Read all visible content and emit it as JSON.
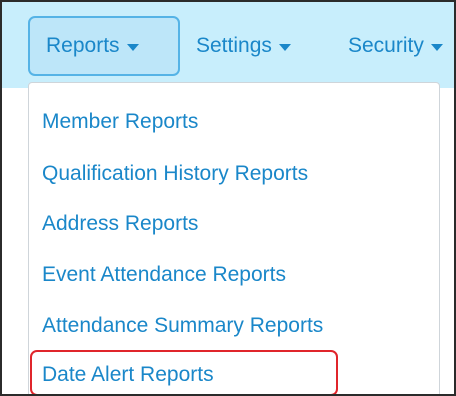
{
  "navbar": {
    "items": [
      {
        "label": "Reports"
      },
      {
        "label": "Settings"
      },
      {
        "label": "Security"
      }
    ]
  },
  "dropdown": {
    "items": [
      {
        "label": "Member Reports"
      },
      {
        "label": "Qualification History Reports"
      },
      {
        "label": "Address Reports"
      },
      {
        "label": "Event Attendance Reports"
      },
      {
        "label": "Attendance Summary Reports"
      },
      {
        "label": "Date Alert Reports",
        "highlighted": true
      }
    ]
  },
  "colors": {
    "navbar_bg": "#c8eefc",
    "link": "#1a87c9",
    "active_border": "#55b3e6",
    "highlight_border": "#e0252b"
  }
}
